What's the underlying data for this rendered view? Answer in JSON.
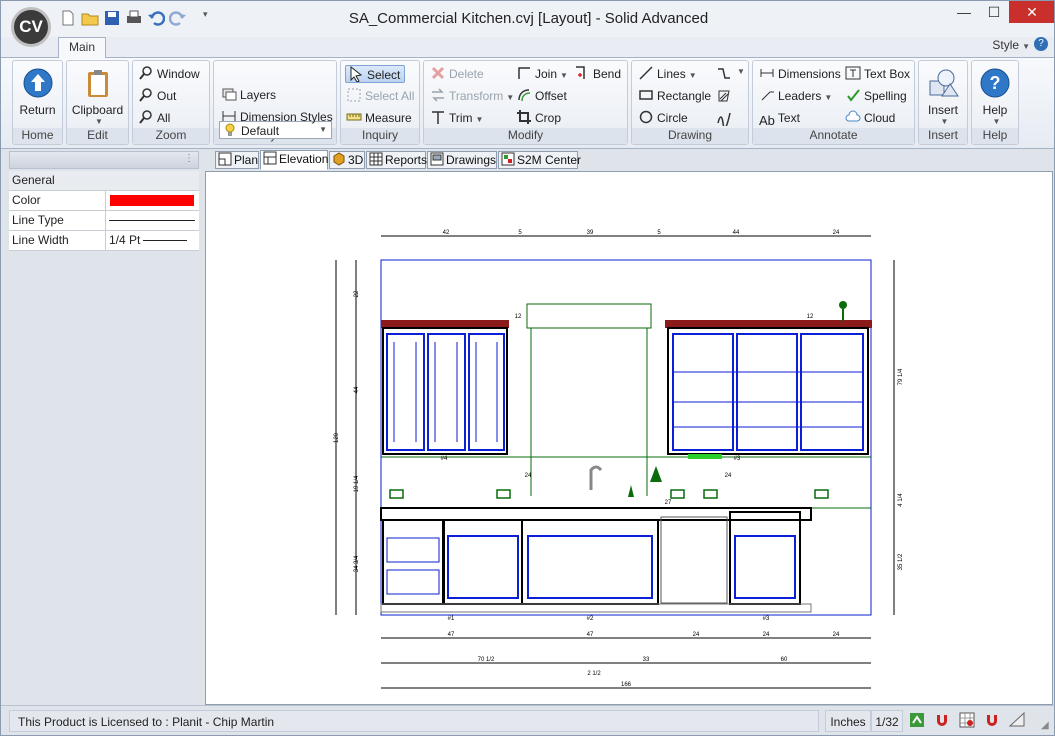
{
  "app": {
    "logo_text": "CV",
    "title": "SA_Commercial Kitchen.cvj [Layout] - Solid Advanced"
  },
  "window_controls": {
    "minimize": "—",
    "maximize": "☐",
    "close": "✕"
  },
  "ribbon_tab": "Main",
  "style_menu": "Style",
  "help_glyph": "?",
  "groups": {
    "home": "Home",
    "edit": "Edit",
    "zoom": "Zoom",
    "layers": "Layers",
    "inquiry": "Inquiry",
    "modify": "Modify",
    "drawing": "Drawing",
    "annotate": "Annotate",
    "insert": "Insert",
    "help": "Help"
  },
  "buttons": {
    "return": "Return",
    "clipboard": "Clipboard",
    "window": "Window",
    "out": "Out",
    "all": "All",
    "layer_default": "Default",
    "layers": "Layers",
    "dimension_styles": "Dimension Styles",
    "select": "Select",
    "select_all": "Select All",
    "measure": "Measure",
    "delete": "Delete",
    "transform": "Transform",
    "trim": "Trim",
    "join": "Join",
    "offset": "Offset",
    "crop": "Crop",
    "bend": "Bend",
    "lines": "Lines",
    "rectangle": "Rectangle",
    "circle": "Circle",
    "dimensions": "Dimensions",
    "leaders": "Leaders",
    "text": "Text",
    "text_box": "Text Box",
    "spelling": "Spelling",
    "cloud": "Cloud",
    "insert": "Insert",
    "help": "Help"
  },
  "properties": {
    "category": "General",
    "rows": [
      {
        "name": "Color",
        "value": "",
        "swatch": "#ff0000"
      },
      {
        "name": "Line Type",
        "value": ""
      },
      {
        "name": "Line Width",
        "value": "1/4 Pt"
      }
    ]
  },
  "doc_tabs": [
    "Plan",
    "Elevation",
    "3D",
    "Reports",
    "Drawings",
    "S2M Center"
  ],
  "active_tab": "Elevation",
  "drawing": {
    "top_dims": [
      "42",
      "5",
      "39",
      "5",
      "44",
      "24"
    ],
    "left_dims": [
      "22",
      "44",
      "120",
      "19 1/4",
      "34 3/4"
    ],
    "right_dims": [
      "79 1/4",
      "4 1/4",
      "35 1/2"
    ],
    "cabinet_tags": [
      "#4",
      "#3",
      "#1",
      "#2",
      "#3"
    ],
    "small_labels": [
      "12",
      "12",
      "24",
      "24",
      "27"
    ],
    "bottom_dims_row1": [
      "47",
      "47",
      "24",
      "24",
      "24"
    ],
    "bottom_dims_row2": [
      "70 1/2",
      "33",
      "60"
    ],
    "bottom_dim_small": "2 1/2",
    "bottom_dims_total": "166"
  },
  "status": {
    "license": "This Product is Licensed to : Planit - Chip Martin",
    "units": "Inches",
    "scale": "1/32"
  },
  "colors": {
    "cabinet_blue": "#0a1fd6",
    "outline_green": "#0a6b0a",
    "molding_red": "#8b1a1a",
    "select_highlight": "#bcd3f1"
  }
}
